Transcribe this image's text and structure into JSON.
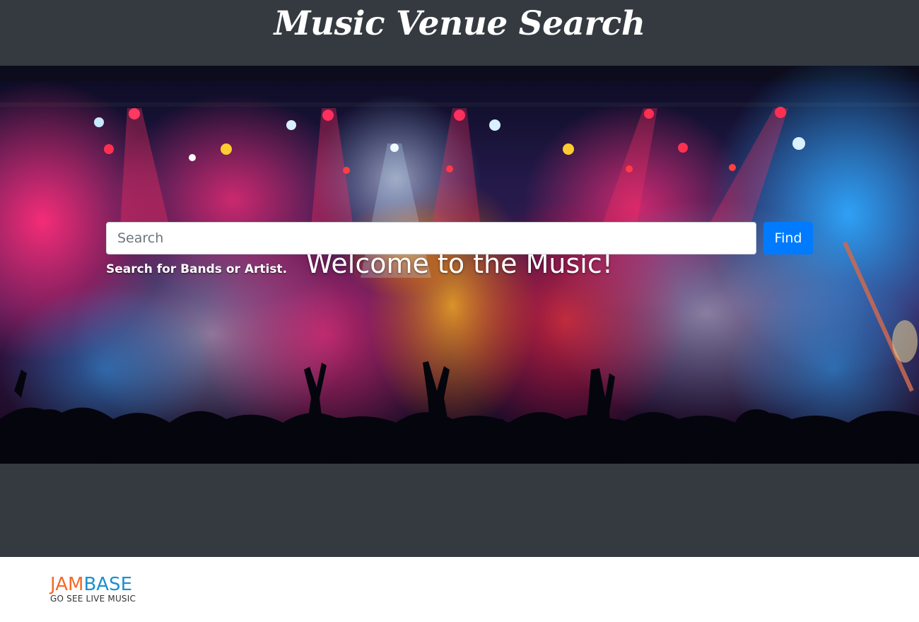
{
  "header": {
    "title": "Music Venue Search"
  },
  "hero": {
    "heading": "Welcome to the Music!",
    "search": {
      "placeholder": "Search",
      "value": ""
    },
    "find_label": "Find",
    "help_text": "Search for Bands or Artist."
  },
  "footer": {
    "logo": {
      "word1": "JAM",
      "word2": "BASE",
      "tagline": "GO SEE LIVE MUSIC"
    }
  },
  "colors": {
    "header_bg": "#343a40",
    "button_blue": "#007bff",
    "logo_orange": "#f26b2a",
    "logo_blue": "#1b8fd1"
  }
}
